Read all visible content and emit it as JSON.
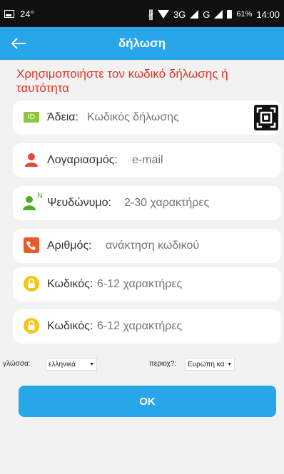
{
  "status_bar": {
    "temperature": "24°",
    "network1": "3G",
    "network2": "G",
    "battery": "61%",
    "time": "14:00"
  },
  "header": {
    "title": "δήλωση"
  },
  "instruction": "Χρησιμοποιήστε τον κωδικό δήλωσης ή ταυτότητα",
  "fields": [
    {
      "label": "Άδεια:",
      "placeholder": "Κωδικός δήλωσης",
      "icon": "id-icon"
    },
    {
      "label": "Λογαριασμός:",
      "placeholder": "e-mail",
      "icon": "user-icon"
    },
    {
      "label": "Ψευδώνυμο:",
      "placeholder": "2-30 χαρακτήρες",
      "icon": "nickname-icon"
    },
    {
      "label": "Αριθμός:",
      "placeholder": "ανάκτηση κωδικού",
      "icon": "phone-icon"
    },
    {
      "label": "Κωδικός:",
      "placeholder": "6-12 χαρακτήρες",
      "icon": "lock-icon"
    },
    {
      "label": "Κωδικός:",
      "placeholder": "6-12 χαρακτήρες",
      "icon": "lock-icon"
    }
  ],
  "id_badge": "ID",
  "nickname_badge": "N",
  "language": {
    "label": "γλώσσα:",
    "value": "ελληνικά"
  },
  "region": {
    "label": "περιοχ?:",
    "value": "Ευρώπη κα"
  },
  "ok_button": "OK",
  "colors": {
    "accent": "#27a7ea",
    "error_text": "#e53325",
    "background": "#f2f2f2"
  }
}
